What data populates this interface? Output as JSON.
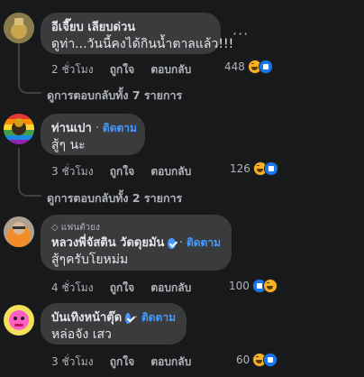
{
  "comments": [
    {
      "author": "อีเจี๊ยบ เลียบด่วน",
      "text": "ดูท่า...วันนี้คงได้กินน้ำตาลแล้ว!!!",
      "time": "2 ชั่วโมง",
      "like_label": "ถูกใจ",
      "reply_label": "ตอบกลับ",
      "reaction_count": "448",
      "replies_text": "ดูการตอบกลับทั้ง 7 รายการ",
      "more_icon": "more-options-icon"
    },
    {
      "author": "ท่านเปา",
      "follow_label": "ติดตาม",
      "text": "สู้ๆ นะ",
      "time": "3 ชั่วโมง",
      "like_label": "ถูกใจ",
      "reply_label": "ตอบกลับ",
      "reaction_count": "126",
      "replies_text": "ดูการตอบกลับทั้ง 2 รายการ"
    },
    {
      "badge": "แฟนตัวยง",
      "author": "หลวงพี่จัสติน วัดดุยมัน",
      "follow_label": "ติดตาม",
      "text": "สู้ๆครับโยหม่ม",
      "time": "4 ชั่วโมง",
      "like_label": "ถูกใจ",
      "reply_label": "ตอบกลับ",
      "reaction_count": "100"
    },
    {
      "author": "บันเทิงหน้าตุ๊ด",
      "follow_label": "ติดตาม",
      "text": "หล่อจัง เสว",
      "time": "3 ชั่วโมง",
      "like_label": "ถูกใจ",
      "reply_label": "ตอบกลับ",
      "reaction_count": "60"
    }
  ],
  "colors": {
    "background": "#18191a",
    "bubble": "#3a3b3c",
    "follow": "#4599ff",
    "secondary_text": "#b0b3b8"
  }
}
